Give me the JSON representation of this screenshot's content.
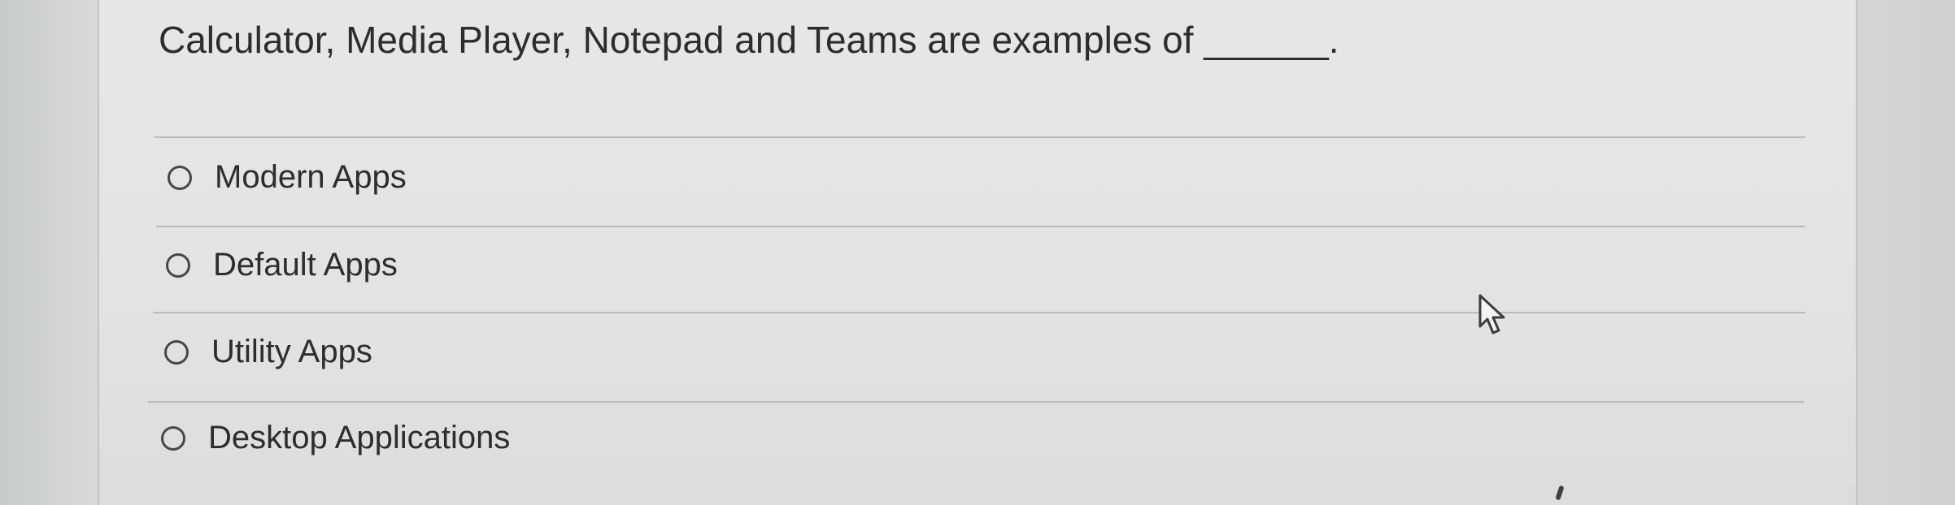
{
  "question": {
    "text": "Calculator, Media Player, Notepad and Teams are examples of ______."
  },
  "options": [
    {
      "label": "Modern Apps",
      "selected": false
    },
    {
      "label": "Default Apps",
      "selected": false
    },
    {
      "label": "Utility Apps",
      "selected": false
    },
    {
      "label": "Desktop Applications",
      "selected": false
    }
  ],
  "icons": {
    "cursor": "mouse-pointer-icon",
    "radio": "radio-button-icon"
  },
  "colors": {
    "text": "#2b2d2f",
    "divider": "#b9bcbc",
    "background": "#e3e4e3"
  }
}
